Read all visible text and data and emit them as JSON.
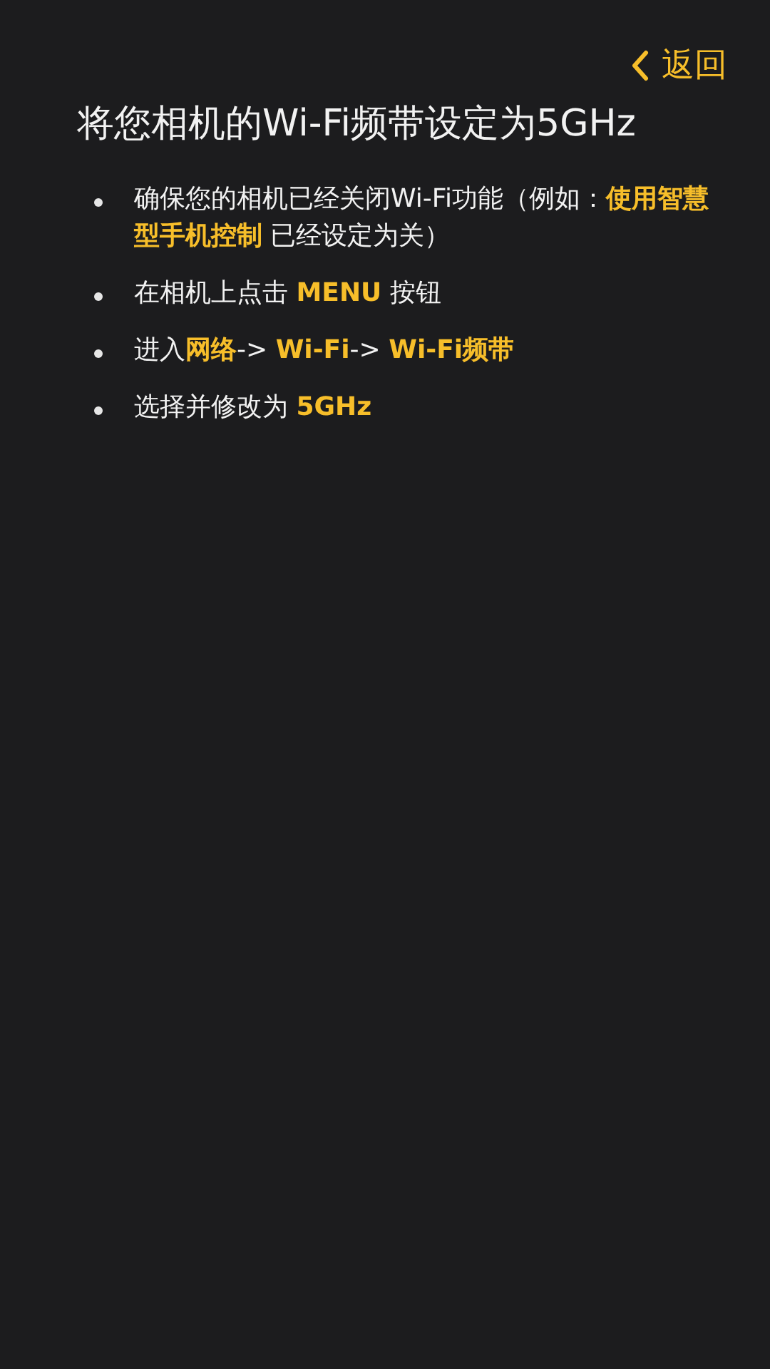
{
  "back_link": {
    "label": "返回"
  },
  "title": "将您相机的Wi-Fi频带设定为5GHz",
  "steps": [
    "确保您的相机已经关闭Wi-Fi功能（例如：**使用智慧型手机控制** 已经设定为关）",
    "在相机上点击 **MENU** 按钮",
    "进入**网络**-> **Wi-Fi**-> **Wi-Fi频带**",
    "选择并修改为 **5GHz**"
  ]
}
